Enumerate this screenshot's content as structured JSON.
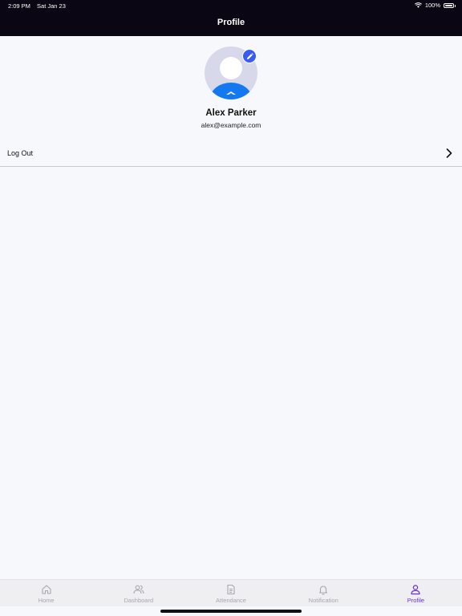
{
  "status_bar": {
    "time": "2:09 PM",
    "date": "Sat Jan 23",
    "battery": "100%"
  },
  "header": {
    "title": "Profile"
  },
  "profile": {
    "name": "Alex Parker",
    "email": "alex@example.com"
  },
  "menu": {
    "logout_label": "Log Out"
  },
  "tabs": [
    {
      "label": "Home",
      "icon": "home-icon"
    },
    {
      "label": "Dashboard",
      "icon": "users-icon"
    },
    {
      "label": "Attendance",
      "icon": "document-icon"
    },
    {
      "label": "Notification",
      "icon": "bell-icon"
    },
    {
      "label": "Profile",
      "icon": "person-icon"
    }
  ],
  "active_tab": "Profile",
  "colors": {
    "header_bg": "#0b0613",
    "page_bg": "#f7f8fc",
    "accent_active": "#6a2fd0",
    "avatar_body": "#1479f0",
    "edit_badge": "#3a5bf0"
  }
}
